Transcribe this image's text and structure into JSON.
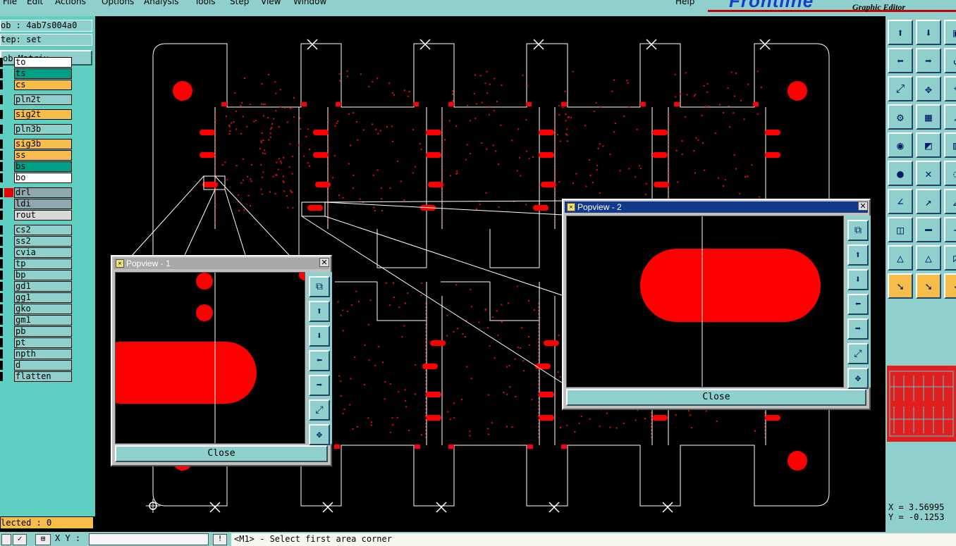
{
  "menubar": {
    "items": [
      "File",
      "Edit",
      "Actions",
      "Options",
      "Analysis",
      "Tools",
      "Step",
      "View",
      "Window",
      "Help"
    ]
  },
  "brand": {
    "logo_text": "Frontline",
    "subtitle": "Graphic Editor"
  },
  "left_panel": {
    "job_label": "ob : 4ab7s004a0",
    "step_label": "tep: set",
    "job_matrix_button": "ob Matrix ...",
    "layers": [
      {
        "name": "to",
        "color": "#ffffff"
      },
      {
        "name": "ts",
        "color": "#00a087"
      },
      {
        "name": "cs",
        "color": "#f7bd4a"
      },
      {
        "name": "pln2t",
        "color": "#8fd0cc"
      },
      {
        "name": "sig2t",
        "color": "#f7bd4a"
      },
      {
        "name": "pln3b",
        "color": "#8fd0cc"
      },
      {
        "name": "sig3b",
        "color": "#f7bd4a"
      },
      {
        "name": "ss",
        "color": "#f7bd4a"
      },
      {
        "name": "bs",
        "color": "#00a087"
      },
      {
        "name": "bo",
        "color": "#ffffff"
      },
      {
        "name": "drl",
        "color": "#8fa8b0"
      },
      {
        "name": "ldi",
        "color": "#8fa8b0"
      },
      {
        "name": "rout",
        "color": "#d8d8d8"
      },
      {
        "name": "cs2",
        "color": "#8fd0cc"
      },
      {
        "name": "ss2",
        "color": "#8fd0cc"
      },
      {
        "name": "cvia",
        "color": "#8fd0cc"
      },
      {
        "name": "tp",
        "color": "#8fd0cc"
      },
      {
        "name": "bp",
        "color": "#8fd0cc"
      },
      {
        "name": "gd1",
        "color": "#8fd0cc"
      },
      {
        "name": "gg1",
        "color": "#8fd0cc"
      },
      {
        "name": "gko",
        "color": "#8fd0cc"
      },
      {
        "name": "gm1",
        "color": "#8fd0cc"
      },
      {
        "name": "pb",
        "color": "#8fd0cc"
      },
      {
        "name": "pt",
        "color": "#8fd0cc"
      },
      {
        "name": "npth",
        "color": "#8fd0cc"
      },
      {
        "name": "d",
        "color": "#8fd0cc"
      },
      {
        "name": "flatten",
        "color": "#8fd0cc"
      }
    ]
  },
  "status": {
    "selected": "lected : 0",
    "xy_label": "X Y :",
    "prompt": "<M1> - Select first area corner",
    "coord_x": "X = 3.56995",
    "coord_y": "Y = -0.1253"
  },
  "popview1": {
    "title": "Popview - 1",
    "close_label": "Close"
  },
  "popview2": {
    "title": "Popview - 2",
    "close_label": "Close"
  },
  "colors": {
    "pad": "#ff0000",
    "outline": "#ffffff",
    "panel": "#8fd0cc",
    "accent": "#f7bd4a"
  }
}
